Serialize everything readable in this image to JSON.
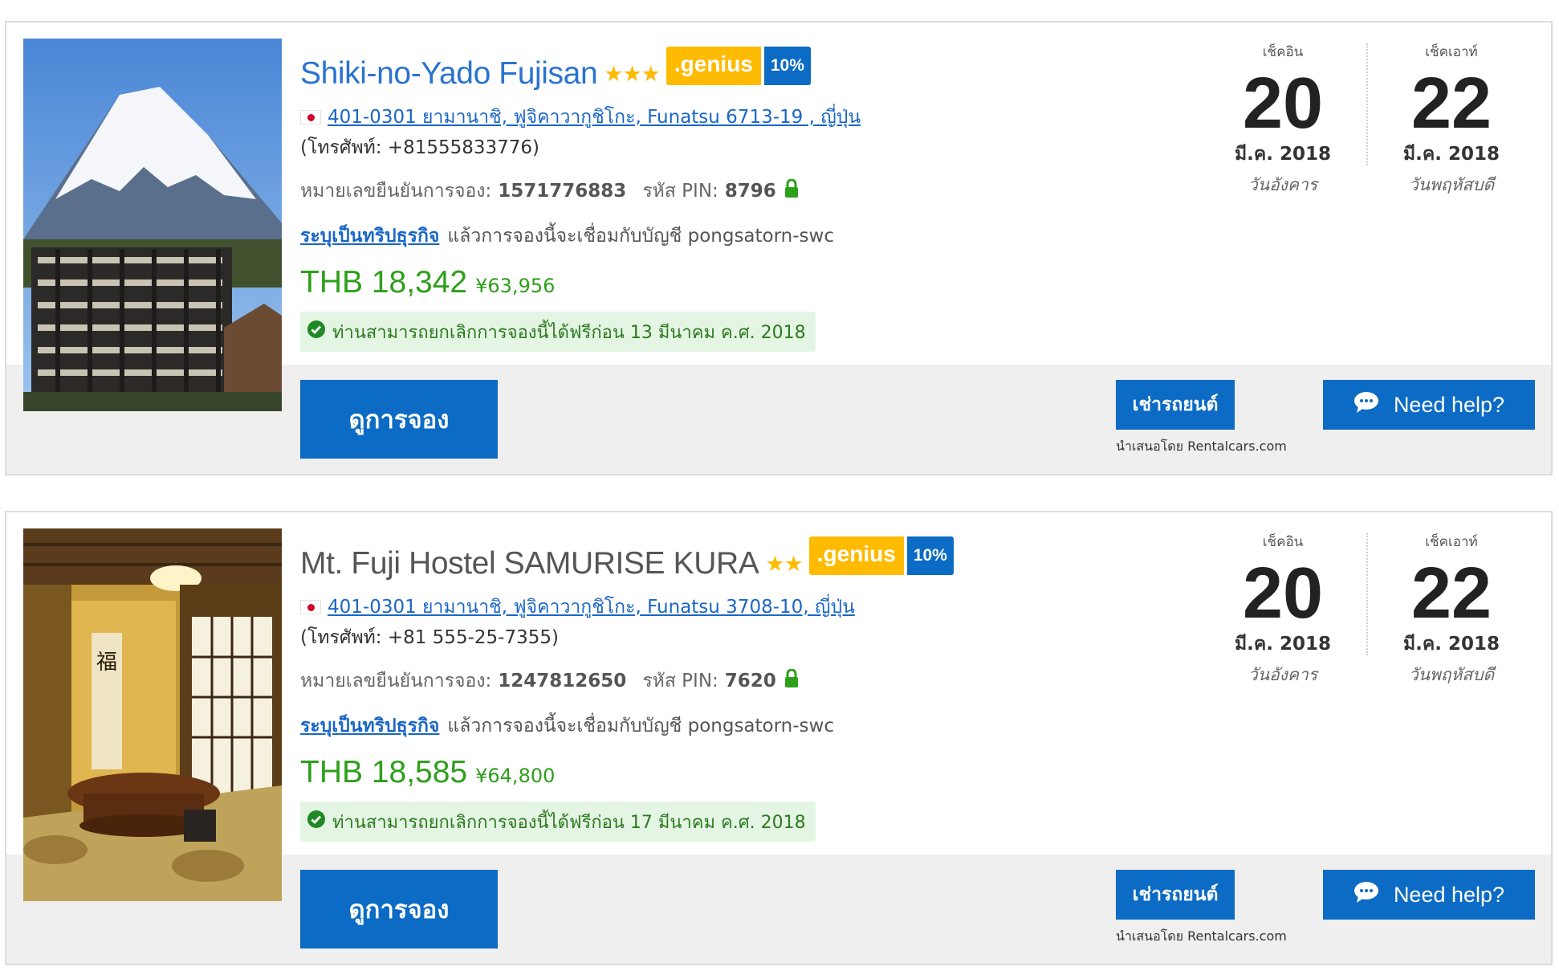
{
  "bookings": [
    {
      "hotel_name": "Shiki-no-Yado Fujisan",
      "stars": "★★★",
      "genius_label": ".genius",
      "genius_discount": "10%",
      "address": "401-0301 ยามานาชิ, ฟูจิคาวากูชิโกะ, Funatsu 6713-19 , ญี่ปุ่น",
      "phone": "(โทรศัพท์: +81555833776)",
      "confirmation_label": "หมายเลขยืนยันการจอง:",
      "confirmation_number": "1571776883",
      "pin_label": "รหัส PIN:",
      "pin": "8796",
      "business_link": "ระบุเป็นทริปธุรกิจ",
      "business_text": "แล้วการจองนี้จะเชื่อมกับบัญชี pongsatorn-swc",
      "price_thb": "THB 18,342",
      "price_jpy": "¥63,956",
      "cancellation": "ท่านสามารถยกเลิกการจองนี้ได้ฟรีก่อน 13 มีนาคม ค.ศ. 2018",
      "checkin_label": "เช็คอิน",
      "checkin_day": "20",
      "checkin_month": "มี.ค. 2018",
      "checkin_weekday": "วันอังคาร",
      "checkout_label": "เช็คเอาท์",
      "checkout_day": "22",
      "checkout_month": "มี.ค. 2018",
      "checkout_weekday": "วันพฤหัสบดี",
      "view_button": "ดูการจอง",
      "car_button": "เช่ารถยนต์",
      "offered_by": "นำเสนอโดย Rentalcars.com",
      "help_button": "Need help?"
    },
    {
      "hotel_name": "Mt. Fuji Hostel SAMURISE KURA",
      "stars": "★★",
      "genius_label": ".genius",
      "genius_discount": "10%",
      "address": "401-0301 ยามานาชิ, ฟูจิคาวากูชิโกะ, Funatsu 3708-10, ญี่ปุ่น",
      "phone": "(โทรศัพท์: +81 555-25-7355)",
      "confirmation_label": "หมายเลขยืนยันการจอง:",
      "confirmation_number": "1247812650",
      "pin_label": "รหัส PIN:",
      "pin": "7620",
      "business_link": "ระบุเป็นทริปธุรกิจ",
      "business_text": "แล้วการจองนี้จะเชื่อมกับบัญชี pongsatorn-swc",
      "price_thb": "THB 18,585",
      "price_jpy": "¥64,800",
      "cancellation": "ท่านสามารถยกเลิกการจองนี้ได้ฟรีก่อน 17 มีนาคม ค.ศ. 2018",
      "checkin_label": "เช็คอิน",
      "checkin_day": "20",
      "checkin_month": "มี.ค. 2018",
      "checkin_weekday": "วันอังคาร",
      "checkout_label": "เช็คเอาท์",
      "checkout_day": "22",
      "checkout_month": "มี.ค. 2018",
      "checkout_weekday": "วันพฤหัสบดี",
      "view_button": "ดูการจอง",
      "car_button": "เช่ารถยนต์",
      "offered_by": "นำเสนอโดย Rentalcars.com",
      "help_button": "Need help?"
    }
  ],
  "icons": {
    "flag": "japan-flag-icon",
    "lock": "lock-icon",
    "check": "check-circle-icon",
    "chat": "chat-bubble-icon",
    "star": "star-icon"
  },
  "colors": {
    "primary_blue": "#0c6bc4",
    "link_blue": "#1a66c8",
    "price_green": "#2e9f1b",
    "genius_yellow": "#febb02",
    "star_yellow": "#febb02",
    "cancel_bg": "#e4f5e4",
    "action_bar_bg": "#efefef"
  }
}
